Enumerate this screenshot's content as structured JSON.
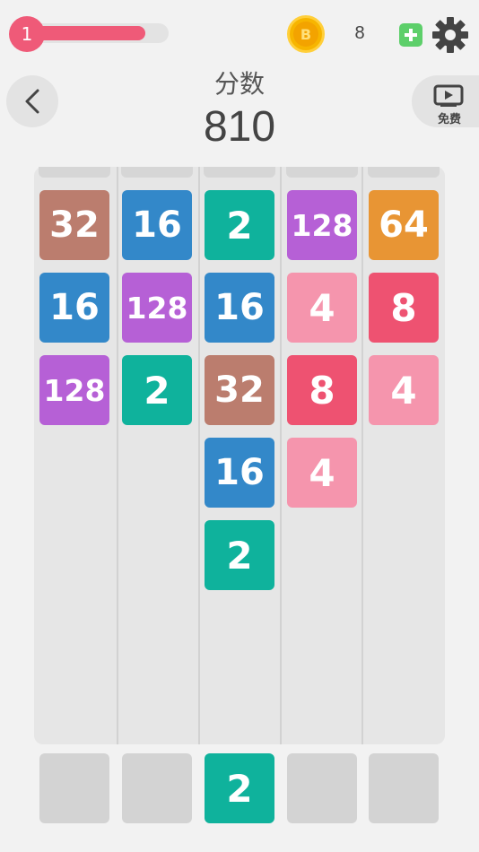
{
  "top_bar": {
    "level": "1",
    "level_progress": 0.84,
    "coin_symbol": "B",
    "coin_count": "8",
    "icons": [
      "coin-icon",
      "plus-icon",
      "gear-icon"
    ]
  },
  "header": {
    "score_label": "分数",
    "score_value": "810",
    "free_label": "免费",
    "icons": [
      "back-arrow-icon",
      "video-play-icon"
    ]
  },
  "board": {
    "columns": [
      [
        "32",
        "16",
        "128"
      ],
      [
        "16",
        "128",
        "2"
      ],
      [
        "2",
        "16",
        "32",
        "16",
        "2"
      ],
      [
        "128",
        "4",
        "8",
        "4"
      ],
      [
        "64",
        "8",
        "4"
      ]
    ]
  },
  "bottom_slots": {
    "slots": [
      "",
      "",
      "2",
      "",
      ""
    ]
  },
  "colors": {
    "tile_2": "#0fb29c",
    "tile_4": "#f595ad",
    "tile_8": "#ee5271",
    "tile_16": "#3388c9",
    "tile_32": "#bb7d6e",
    "tile_64": "#e89534",
    "tile_128": "#b660d6",
    "accent": "#ef5a78"
  }
}
